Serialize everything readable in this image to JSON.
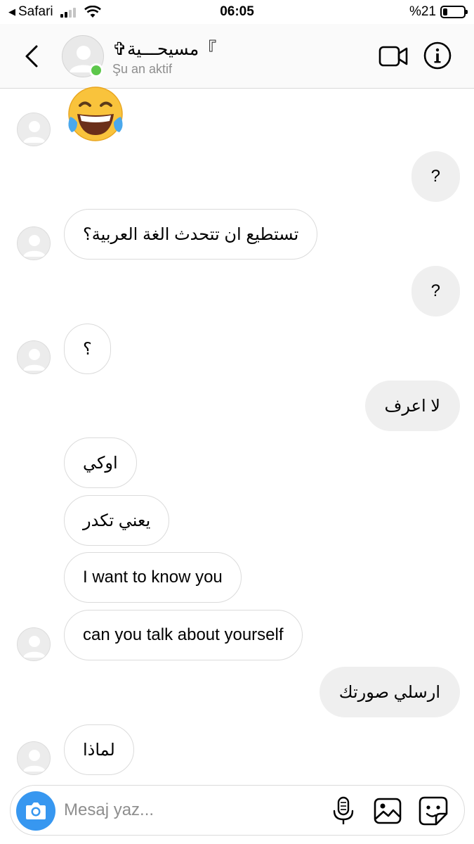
{
  "status_bar": {
    "back_app": "Safari",
    "time": "06:05",
    "battery_text": "%21",
    "battery_level": 0.21
  },
  "header": {
    "contact_name": "✞مسيحـــية『",
    "status": "Şu an aktif",
    "icons": [
      "chevron-left-icon",
      "avatar",
      "video-camera-icon",
      "info-icon"
    ]
  },
  "messages": [
    {
      "side": "in",
      "type": "emoji",
      "text": "😂",
      "icon": "tears-of-joy-emoji"
    },
    {
      "side": "out",
      "type": "text",
      "text": "?"
    },
    {
      "side": "in",
      "type": "text",
      "text": "تستطيع ان تتحدث الغة العربية؟"
    },
    {
      "side": "out",
      "type": "text",
      "text": "?"
    },
    {
      "side": "in",
      "type": "text",
      "text": "؟"
    },
    {
      "side": "out",
      "type": "text",
      "text": "لا اعرف"
    },
    {
      "side": "in",
      "type": "text",
      "text": "اوكي"
    },
    {
      "side": "in",
      "type": "text",
      "text": "يعني تكدر"
    },
    {
      "side": "in",
      "type": "text",
      "text": "I want to know you"
    },
    {
      "side": "in",
      "type": "text",
      "text": "can you talk about yourself"
    },
    {
      "side": "out",
      "type": "text",
      "text": "ارسلي صورتك"
    },
    {
      "side": "in",
      "type": "text",
      "text": "لماذا"
    }
  ],
  "composer": {
    "placeholder": "Mesaj yaz...",
    "icons": [
      "camera-icon",
      "microphone-icon",
      "gallery-icon",
      "sticker-icon"
    ]
  },
  "colors": {
    "accent": "#3797f0",
    "online": "#5dc74b",
    "outgoing_bubble": "#efefef",
    "border": "#dbdbdb"
  }
}
